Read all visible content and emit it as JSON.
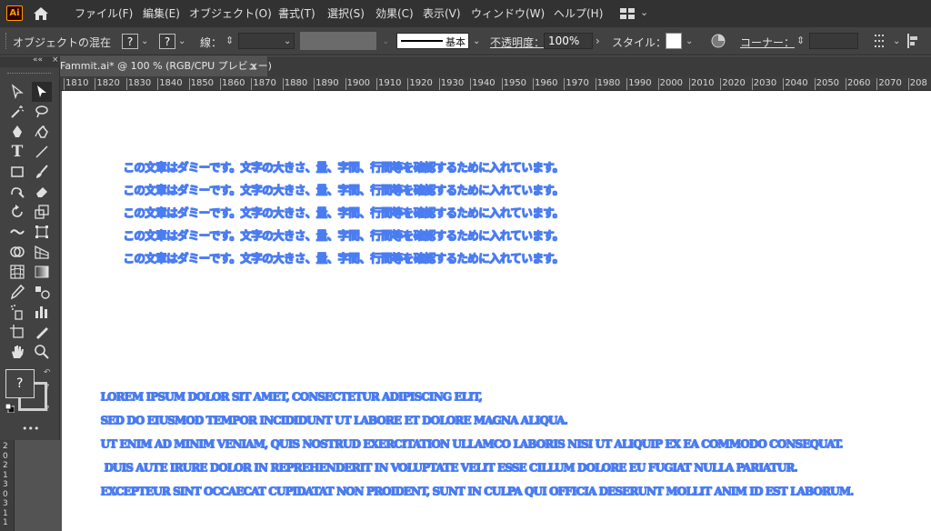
{
  "menubar": {
    "logo": "Ai",
    "items": [
      "ファイル(F)",
      "編集(E)",
      "オブジェクト(O)",
      "書式(T)",
      "選択(S)",
      "効果(C)",
      "表示(V)",
      "ウィンドウ(W)",
      "ヘルプ(H)"
    ]
  },
  "control": {
    "blend_label": "オブジェクトの混在",
    "fill_q": "?",
    "stroke_q": "?",
    "stroke_label": "線：",
    "brush_label": "基本",
    "opacity_label": "不透明度：",
    "opacity_value": "100%",
    "style_label": "スタイル：",
    "corner_label": "コーナー："
  },
  "tab": {
    "title": "Fammit.ai* @ 100 % (RGB/CPU プレビュー)",
    "close": "×"
  },
  "tools": {
    "header_collapse": "««",
    "fill_q": "?",
    "small_q": "?",
    "more": "•••"
  },
  "ruler": {
    "labels": [
      "1810",
      "1820",
      "1830",
      "1840",
      "1850",
      "1860",
      "1870",
      "1880",
      "1890",
      "1900",
      "1910",
      "1920",
      "1930",
      "1940",
      "1950",
      "1960",
      "1970",
      "1980",
      "1990",
      "2000",
      "2010",
      "2020",
      "2030",
      "2040",
      "2050",
      "2060",
      "2070",
      "208"
    ],
    "vertical": [
      "2",
      "0",
      "2",
      "1",
      "3",
      "0",
      "3",
      "1",
      "1"
    ]
  },
  "canvas": {
    "jp_lines": [
      "この文章はダミーです。文字の大きさ、量、字間、行間等を確認するために入れています。",
      "この文章はダミーです。文字の大きさ、量、字間、行間等を確認するために入れています。",
      "この文章はダミーです。文字の大きさ、量、字間、行間等を確認するために入れています。",
      "この文章はダミーです。文字の大きさ、量、字間、行間等を確認するために入れています。",
      "この文章はダミーです。文字の大きさ、量、字間、行間等を確認するために入れています。"
    ],
    "en_lines": [
      "LOREM IPSUM DOLOR SIT AMET, CONSECTETUR ADIPISCING ELIT,",
      "SED DO EIUSMOD TEMPOR INCIDIDUNT UT LABORE ET DOLORE MAGNA ALIQUA.",
      "UT ENIM AD MINIM VENIAM, QUIS NOSTRUD EXERCITATION ULLAMCO LABORIS NISI UT ALIQUIP EX EA COMMODO CONSEQUAT.",
      "DUIS AUTE IRURE DOLOR IN REPREHENDERIT IN VOLUPTATE VELIT ESSE CILLUM DOLORE EU FUGIAT NULLA PARIATUR.",
      "EXCEPTEUR SINT OCCAECAT CUPIDATAT NON PROIDENT, SUNT IN CULPA QUI OFFICIA DESERUNT MOLLIT ANIM ID EST LABORUM."
    ],
    "text_color": "#4a7cf2"
  },
  "icons": [
    "home-icon",
    "workspace-icon",
    "recolor-icon",
    "align-icon",
    "selection-tool-icon",
    "direct-selection-icon",
    "magic-wand-icon",
    "lasso-icon",
    "pen-icon",
    "curvature-icon",
    "type-icon",
    "line-icon",
    "rectangle-icon",
    "paintbrush-icon",
    "shaper-icon",
    "eraser-icon",
    "rotate-icon",
    "scale-icon",
    "puppet-warp-icon",
    "free-transform-icon",
    "shape-builder-icon",
    "perspective-icon",
    "mesh-icon",
    "gradient-icon",
    "eyedropper-icon",
    "blend-icon",
    "symbol-sprayer-icon",
    "graph-icon",
    "artboard-icon",
    "slice-icon",
    "hand-icon",
    "zoom-icon"
  ]
}
